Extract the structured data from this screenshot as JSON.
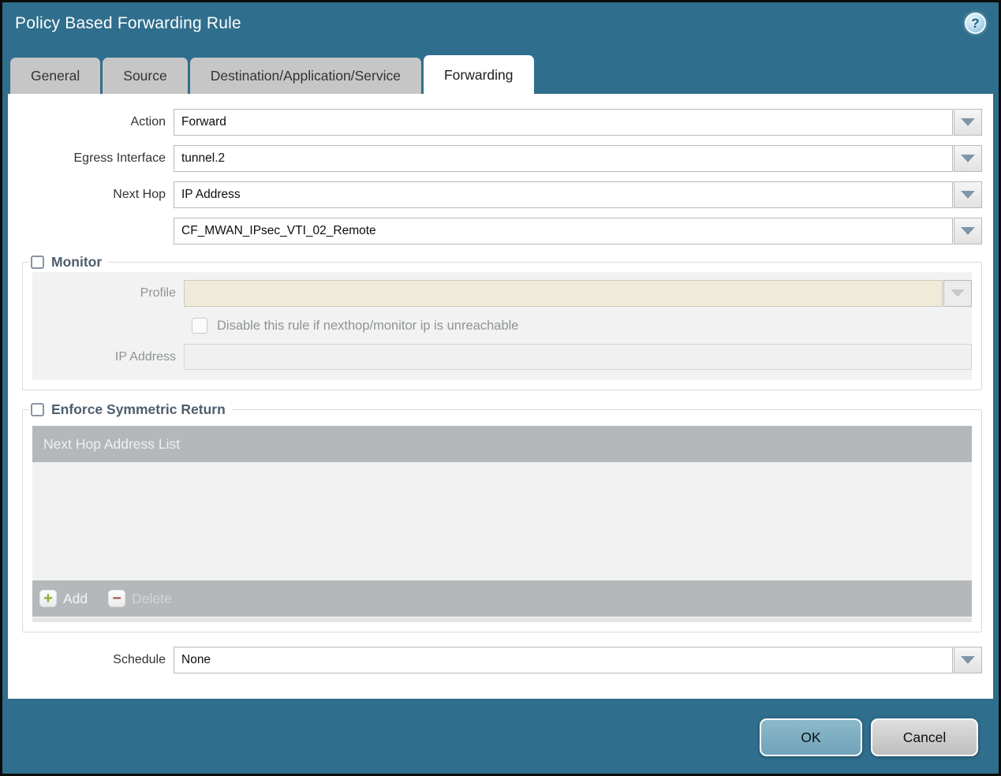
{
  "window": {
    "title": "Policy Based Forwarding Rule",
    "help_icon": "?"
  },
  "tabs": [
    {
      "label": "General",
      "active": false
    },
    {
      "label": "Source",
      "active": false
    },
    {
      "label": "Destination/Application/Service",
      "active": false
    },
    {
      "label": "Forwarding",
      "active": true
    }
  ],
  "form": {
    "action": {
      "label": "Action",
      "value": "Forward"
    },
    "egress_interface": {
      "label": "Egress Interface",
      "value": "tunnel.2"
    },
    "next_hop": {
      "label": "Next Hop",
      "value": "IP Address"
    },
    "next_hop_address": {
      "value": "CF_MWAN_IPsec_VTI_02_Remote"
    },
    "schedule": {
      "label": "Schedule",
      "value": "None"
    }
  },
  "monitor": {
    "title": "Monitor",
    "checked": false,
    "profile_label": "Profile",
    "profile_value": "",
    "disable_checkbox_label": "Disable this rule if nexthop/monitor ip is unreachable",
    "disable_checkbox_checked": false,
    "ip_address_label": "IP Address",
    "ip_address_value": ""
  },
  "symmetric_return": {
    "title": "Enforce Symmetric Return",
    "checked": false,
    "table_header": "Next Hop Address List",
    "rows": [],
    "add_label": "Add",
    "delete_label": "Delete",
    "delete_enabled": false
  },
  "footer": {
    "ok_label": "OK",
    "cancel_label": "Cancel"
  },
  "colors": {
    "titlebar_teal": "#2f6e8d",
    "inactive_tab_gray": "#c6c6c6",
    "table_bar_gray": "#b4b8bb",
    "disabled_field_beige": "#f0ebd8",
    "disabled_field_gray": "#f0f0f0",
    "ok_button_blue": "#7badc1",
    "cancel_button_gray": "#cccccc",
    "add_plus_green": "#8fa733",
    "delete_minus_red": "#a3564d",
    "legend_text": "#4e5d6c"
  }
}
